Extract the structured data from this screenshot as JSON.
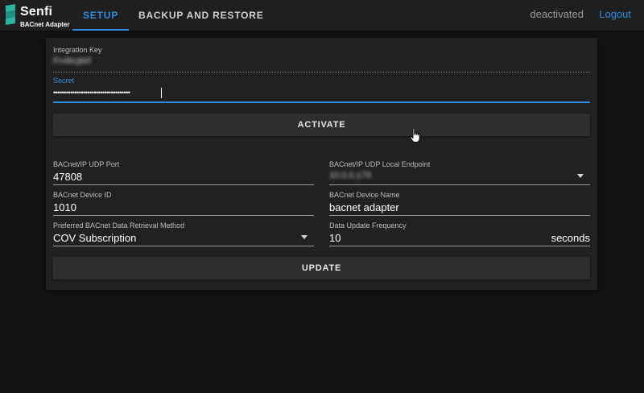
{
  "header": {
    "brand": "Senfi",
    "brand_sub": "BACnet Adapter",
    "tabs": [
      {
        "label": "SETUP",
        "active": true
      },
      {
        "label": "BACKUP AND RESTORE",
        "active": false
      }
    ],
    "status": "deactivated",
    "logout_label": "Logout"
  },
  "activation": {
    "integration_key": {
      "label": "Integration Key",
      "value": "Fn4bcjkkf"
    },
    "secret": {
      "label": "Secret",
      "value": "••••••••••••••••••••••••••••••••••••"
    },
    "activate_label": "ACTIVATE"
  },
  "settings": {
    "udp_port": {
      "label": "BACnet/IP UDP Port",
      "value": "47808"
    },
    "local_endpoint": {
      "label": "BACnet/IP UDP Local Endpoint",
      "value": "10.0.0.179"
    },
    "device_id": {
      "label": "BACnet Device ID",
      "value": "1010"
    },
    "device_name": {
      "label": "BACnet Device Name",
      "value": "bacnet adapter"
    },
    "retrieval_method": {
      "label": "Preferred BACnet Data Retrieval Method",
      "value": "COV Subscription"
    },
    "update_frequency": {
      "label": "Data Update Frequency",
      "value": "10",
      "unit": "seconds"
    },
    "update_label": "UPDATE"
  },
  "colors": {
    "accent": "#2f8ee0",
    "background": "#131313",
    "card": "#212121",
    "button": "#2e2e2e"
  },
  "icons": [
    "senfi-logo-icon",
    "dropdown-arrow-icon",
    "hand-pointer-cursor-icon"
  ]
}
